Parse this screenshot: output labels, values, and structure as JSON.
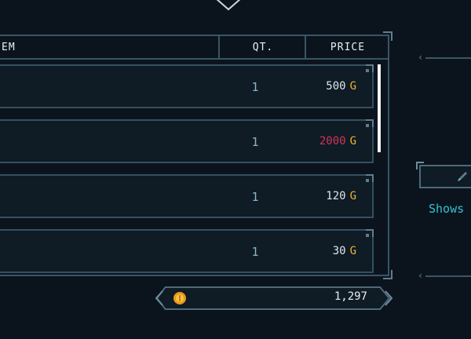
{
  "shop": {
    "headers": {
      "item": "EM",
      "qty": "QT.",
      "price": "PRICE"
    },
    "rows": [
      {
        "qty": "1",
        "price": "500",
        "currency": "G",
        "affordable": true
      },
      {
        "qty": "1",
        "price": "2000",
        "currency": "G",
        "affordable": false
      },
      {
        "qty": "1",
        "price": "120",
        "currency": "G",
        "affordable": true
      },
      {
        "qty": "1",
        "price": "30",
        "currency": "G",
        "affordable": true
      }
    ]
  },
  "wallet": {
    "balance": "1,297",
    "icon": "gold-coin-icon"
  },
  "side_panel": {
    "hint_label": "Shows",
    "hint_icon": "pencil-icon"
  },
  "colors": {
    "gold": "#f2b42a",
    "unaffordable": "#d2355a",
    "frame": "#3a5566",
    "hint_text": "#35c1d6"
  }
}
